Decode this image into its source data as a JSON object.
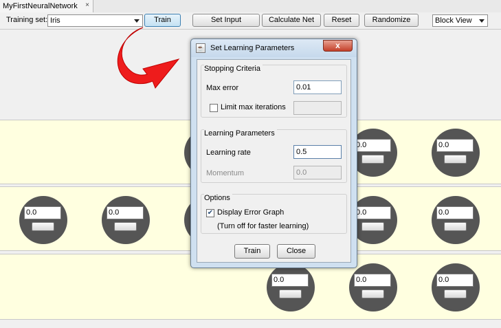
{
  "tab": {
    "title": "MyFirstNeuralNetwork",
    "close_glyph": "×"
  },
  "toolbar": {
    "training_set_label": "Training set:",
    "training_set_value": "Iris",
    "train_label": "Train",
    "set_input_label": "Set Input",
    "calculate_net_label": "Calculate Net",
    "reset_label": "Reset",
    "randomize_label": "Randomize",
    "view_value": "Block View"
  },
  "network": {
    "layers": [
      {
        "neurons": [
          "0.0",
          "0.0"
        ]
      },
      {
        "neurons": [
          "0.0",
          "0.0",
          "0.0",
          "0.0"
        ]
      },
      {
        "neurons": [
          "0.0",
          "0.0",
          "0.0"
        ]
      }
    ]
  },
  "dialog": {
    "title": "Set Learning Parameters",
    "close_glyph": "x",
    "stopping": {
      "title": "Stopping Criteria",
      "max_error_label": "Max error",
      "max_error_value": "0.01",
      "limit_label": "Limit max iterations",
      "limit_checked": false,
      "limit_value": ""
    },
    "learning": {
      "title": "Learning Parameters",
      "rate_label": "Learning rate",
      "rate_value": "0.5",
      "momentum_label": "Momentum",
      "momentum_value": "0.0"
    },
    "options": {
      "title": "Options",
      "display_error_label": "Display Error Graph",
      "display_error_checked": true,
      "note": "(Turn off for faster learning)"
    },
    "train_label": "Train",
    "close_label": "Close"
  },
  "colors": {
    "layer_bg": "#ffffe0",
    "neuron": "#555555",
    "arrow": "#ee1c1c",
    "dialog_frame": "#cfe0f0"
  }
}
